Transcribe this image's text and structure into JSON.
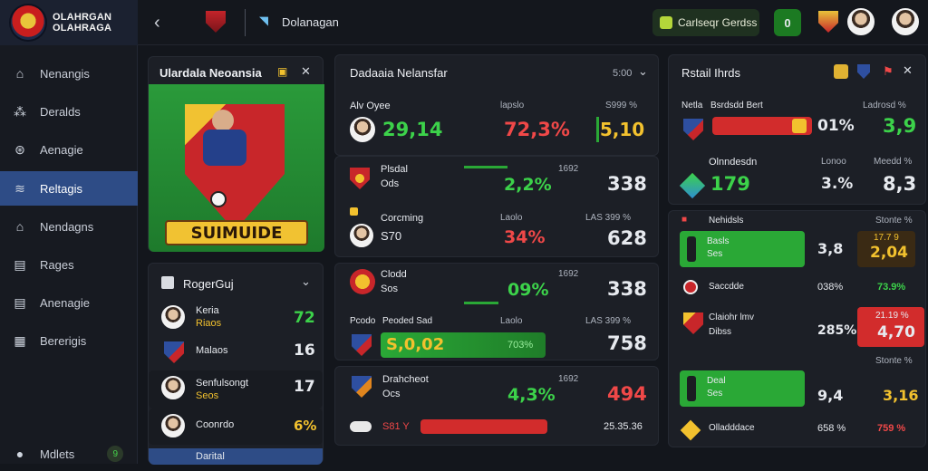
{
  "brand": {
    "line1": "OLAHRGAN",
    "line2": "OLAHRAGA"
  },
  "sidebar": {
    "items": [
      {
        "label": "Nenangis",
        "icon": "home-icon"
      },
      {
        "label": "Deralds",
        "icon": "grid-icon"
      },
      {
        "label": "Aenagie",
        "icon": "compass-icon"
      },
      {
        "label": "Reltagis",
        "icon": "chart-icon"
      },
      {
        "label": "Nendagns",
        "icon": "house-icon"
      },
      {
        "label": "Rages",
        "icon": "list-icon"
      },
      {
        "label": "Anenagie",
        "icon": "table-icon"
      },
      {
        "label": "Bererigis",
        "icon": "calendar-icon"
      }
    ],
    "footer_label": "Mdlets",
    "footer_badge": "9"
  },
  "topbar": {
    "tab_label": "Dolanagan",
    "pill_label": "Carlseqr Gerdss",
    "pill_count": "0"
  },
  "hero": {
    "title": "Ulardala Neoansia",
    "banner_text": "SUIMUIDE"
  },
  "players": {
    "title": "RogerGuj",
    "rows": [
      {
        "name": "Keria",
        "sub": "Riaos",
        "value": "72",
        "color": "green"
      },
      {
        "name": "Malaos",
        "sub": "",
        "value": "16",
        "color": "white"
      },
      {
        "name": "Senfulsongt",
        "sub": "Seos",
        "value": "17",
        "color": "white"
      },
      {
        "name": "Coonrdo",
        "sub": "",
        "value": "6%",
        "color": "yel"
      },
      {
        "name": "Darital",
        "sub": "",
        "value": "",
        "color": "white"
      }
    ]
  },
  "center": {
    "title": "Dadaaia Nelansfar",
    "select": "5:00",
    "card1": {
      "label": "Alv Oyee",
      "value": "29,14",
      "head2": "lapslo",
      "pct": "72,3%",
      "head3": "S999 %",
      "score": "5,10"
    },
    "card2": {
      "rows": [
        {
          "name": "Plsdal",
          "sub": "Ods",
          "head2": "",
          "pct": "2,2%",
          "head3": "1692",
          "score": "338",
          "pctcolor": "green"
        },
        {
          "name": "Corcming",
          "sub": "S70",
          "head2": "Laolo",
          "pct": "34%",
          "head3": "LAS 399 %",
          "score": "628",
          "pctcolor": "red"
        }
      ]
    },
    "card3": {
      "rows": [
        {
          "name": "Clodd",
          "sub": "Sos",
          "head2": "",
          "pct": "09%",
          "head3": "1692",
          "score": "338",
          "pctcolor": "green"
        },
        {
          "name": "Pcodo",
          "sub": "Peoded Sad",
          "head2": "Laolo",
          "pct": "703%",
          "head3": "LAS 399 %",
          "score": "758",
          "bar": "S,0,02",
          "pctcolor": "green"
        }
      ]
    },
    "card4": {
      "rows": [
        {
          "name": "Drahcheot",
          "sub": "Ocs",
          "head3": "1692",
          "pct": "4,3%",
          "score": "494",
          "pctcolor": "green"
        },
        {
          "name": "",
          "sub": "S81 Y",
          "head3": "",
          "pct": "",
          "score": "25.35.36",
          "pctcolor": "red"
        }
      ]
    }
  },
  "right": {
    "title": "Rstail Ihrds",
    "top": {
      "row1_label": "Netla",
      "row1_sub": "Bsrdsdd Bert",
      "row1_head": "Ladrosd %",
      "row1_pct": "01%",
      "row1_score": "3,9",
      "row2_label": "Olnndesdn",
      "row2_value": "179",
      "row2_head": "Lonoo",
      "row2_pct": "3.%",
      "row2_head2": "Meedd %",
      "row2_score": "8,3"
    },
    "list": {
      "head_left": "Nehidsls",
      "head_mid": "",
      "head_right": "Stonte %",
      "rows": [
        {
          "name": "Basls",
          "sub": "Ses",
          "pct": "3,8",
          "score": "2,04",
          "tag": "17.7 9",
          "kind": "green-yel"
        },
        {
          "name": "Saccdde",
          "sub": "",
          "pct": "038%",
          "score": "73.9%",
          "tag": "",
          "kind": "plain"
        },
        {
          "name": "Claiohr lmv",
          "sub": "Dibss",
          "pct": "285%",
          "score": "4,70",
          "tag": "21.19 %",
          "kind": "red"
        },
        {
          "name": "Deal",
          "sub": "Ses",
          "pct": "9,4",
          "score": "3,16",
          "tag": "Stonte %",
          "kind": "green"
        },
        {
          "name": "Olladddace",
          "sub": "",
          "pct": "658 %",
          "score": "759 %",
          "tag": "",
          "kind": "plainred"
        }
      ]
    }
  }
}
